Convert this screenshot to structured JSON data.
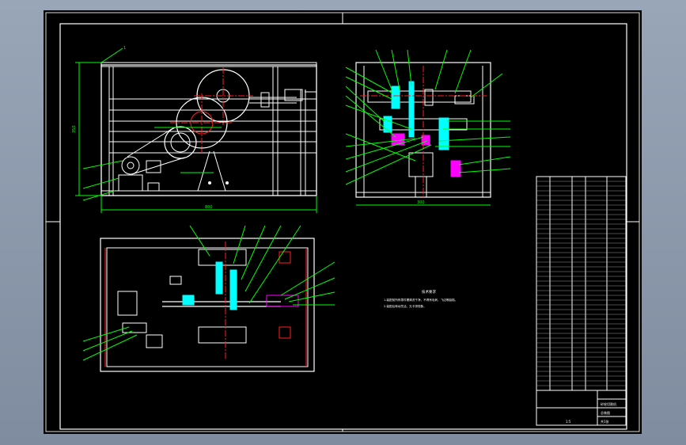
{
  "app": {
    "viewport_background": "#8a96a8",
    "sheet_background": "#000000",
    "palette": {
      "frame": "#ffffff",
      "dimension": "#00ff00",
      "center": "#ff2020",
      "part": "#ffffff",
      "highlight": "#00ffff",
      "accent": "#ff00ff"
    }
  },
  "drawing": {
    "front_view": {
      "labels": {
        "top_callout": "1",
        "left_dim": "350",
        "bottom_dim": "800"
      }
    },
    "side_view": {
      "bottom_dim": "300"
    },
    "plan_view": {
      "callouts": [
        "15",
        "16",
        "17",
        "18",
        "19",
        "20",
        "21"
      ]
    },
    "technical_requirements": {
      "title": "技术要求",
      "lines": [
        "1.装配前所有零件需清洗干净，不得有毛刺、飞边等缺陷。",
        "2.装配后转动灵活，无卡滞现象。"
      ]
    },
    "title_block": {
      "part_name": "砂轮切割机",
      "drawing_no": "总装图",
      "scale": "1:5",
      "sheet": "共1张"
    }
  }
}
